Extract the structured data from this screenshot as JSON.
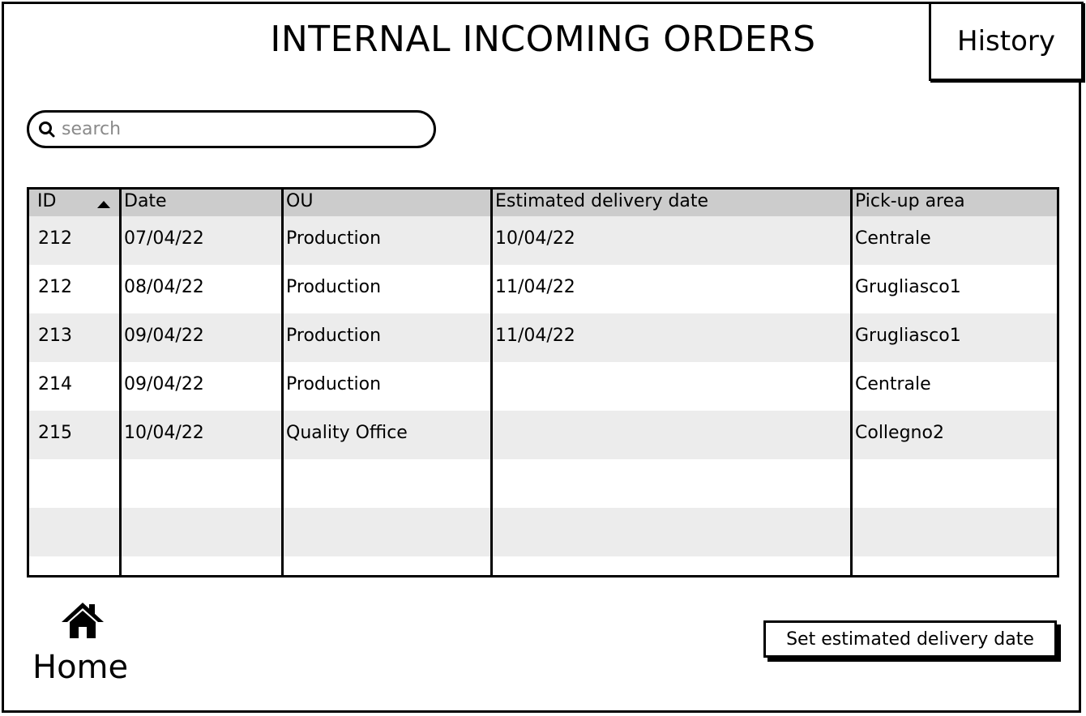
{
  "header": {
    "title": "INTERNAL INCOMING ORDERS",
    "history_label": "History"
  },
  "search": {
    "placeholder": "search",
    "value": "",
    "icon": "search-icon"
  },
  "table": {
    "columns": [
      "ID",
      "Date",
      "OU",
      "Estimated delivery date",
      "Pick-up area"
    ],
    "sort": {
      "column": "ID",
      "direction": "ascending"
    },
    "rows": [
      [
        "212",
        "07/04/22",
        "Production",
        "10/04/22",
        "Centrale"
      ],
      [
        "212",
        "08/04/22",
        "Production",
        "11/04/22",
        "Grugliasco1"
      ],
      [
        "213",
        "09/04/22",
        "Production",
        "11/04/22",
        "Grugliasco1"
      ],
      [
        "214",
        "09/04/22",
        "Production",
        "",
        "Centrale"
      ],
      [
        "215",
        "10/04/22",
        "Quality Office",
        "",
        "Collegno2"
      ],
      [
        "",
        "",
        "",
        "",
        ""
      ],
      [
        "",
        "",
        "",
        "",
        ""
      ],
      [
        "",
        "",
        "",
        "",
        ""
      ]
    ],
    "colors": {
      "header_bg": "#cccccc",
      "stripe_bg": "#ececec"
    }
  },
  "footer": {
    "home_label": "Home",
    "home_icon": "home-icon",
    "set_button_label": "Set estimated delivery date"
  }
}
